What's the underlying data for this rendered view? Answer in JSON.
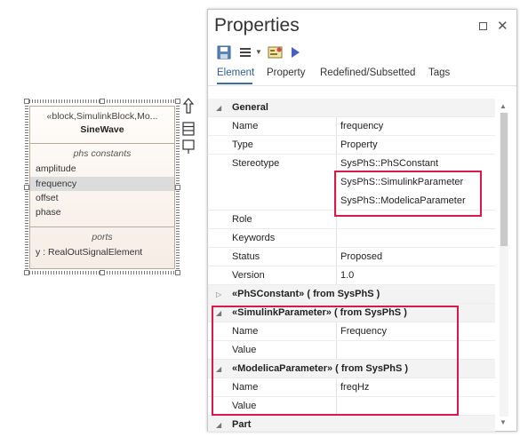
{
  "block": {
    "stereotype": "«block,SimulinkBlock,Mo...",
    "name": "SineWave",
    "compartments": [
      {
        "title": "phs constants",
        "items": [
          "amplitude",
          "frequency",
          "offset",
          "phase"
        ],
        "selected_index": 1
      },
      {
        "title": "ports",
        "items": [
          "y : RealOutSignalElement"
        ]
      }
    ]
  },
  "properties": {
    "title": "Properties",
    "toolbar": {
      "icons": [
        "save-icon",
        "menu-icon",
        "dropdown-arrow-icon",
        "properties-icon",
        "play-icon"
      ]
    },
    "tabs": [
      "Element",
      "Property",
      "Redefined/Subsetted",
      "Tags"
    ],
    "active_tab": "Element",
    "sections": {
      "general": "General",
      "phsconstant": "«PhSConstant» ( from SysPhS )",
      "simulink": "«SimulinkParameter» ( from SysPhS )",
      "modelica": "«ModelicaParameter» ( from SysPhS )",
      "part": "Part"
    },
    "general": {
      "name_label": "Name",
      "name_value": "frequency",
      "type_label": "Type",
      "type_value": "Property",
      "stereotype_label": "Stereotype",
      "stereotypes": [
        "SysPhS::PhSConstant",
        "SysPhS::SimulinkParameter",
        "SysPhS::ModelicaParameter"
      ],
      "role_label": "Role",
      "role_value": "",
      "keywords_label": "Keywords",
      "keywords_value": "",
      "status_label": "Status",
      "status_value": "Proposed",
      "version_label": "Version",
      "version_value": "1.0"
    },
    "simulink": {
      "name_label": "Name",
      "name_value": "Frequency",
      "value_label": "Value",
      "value_value": ""
    },
    "modelica": {
      "name_label": "Name",
      "name_value": "freqHz",
      "value_label": "Value",
      "value_value": ""
    }
  },
  "colors": {
    "highlight": "#d61a4a",
    "accent": "#3b6ea5",
    "block_fill": "#f6ece5"
  }
}
